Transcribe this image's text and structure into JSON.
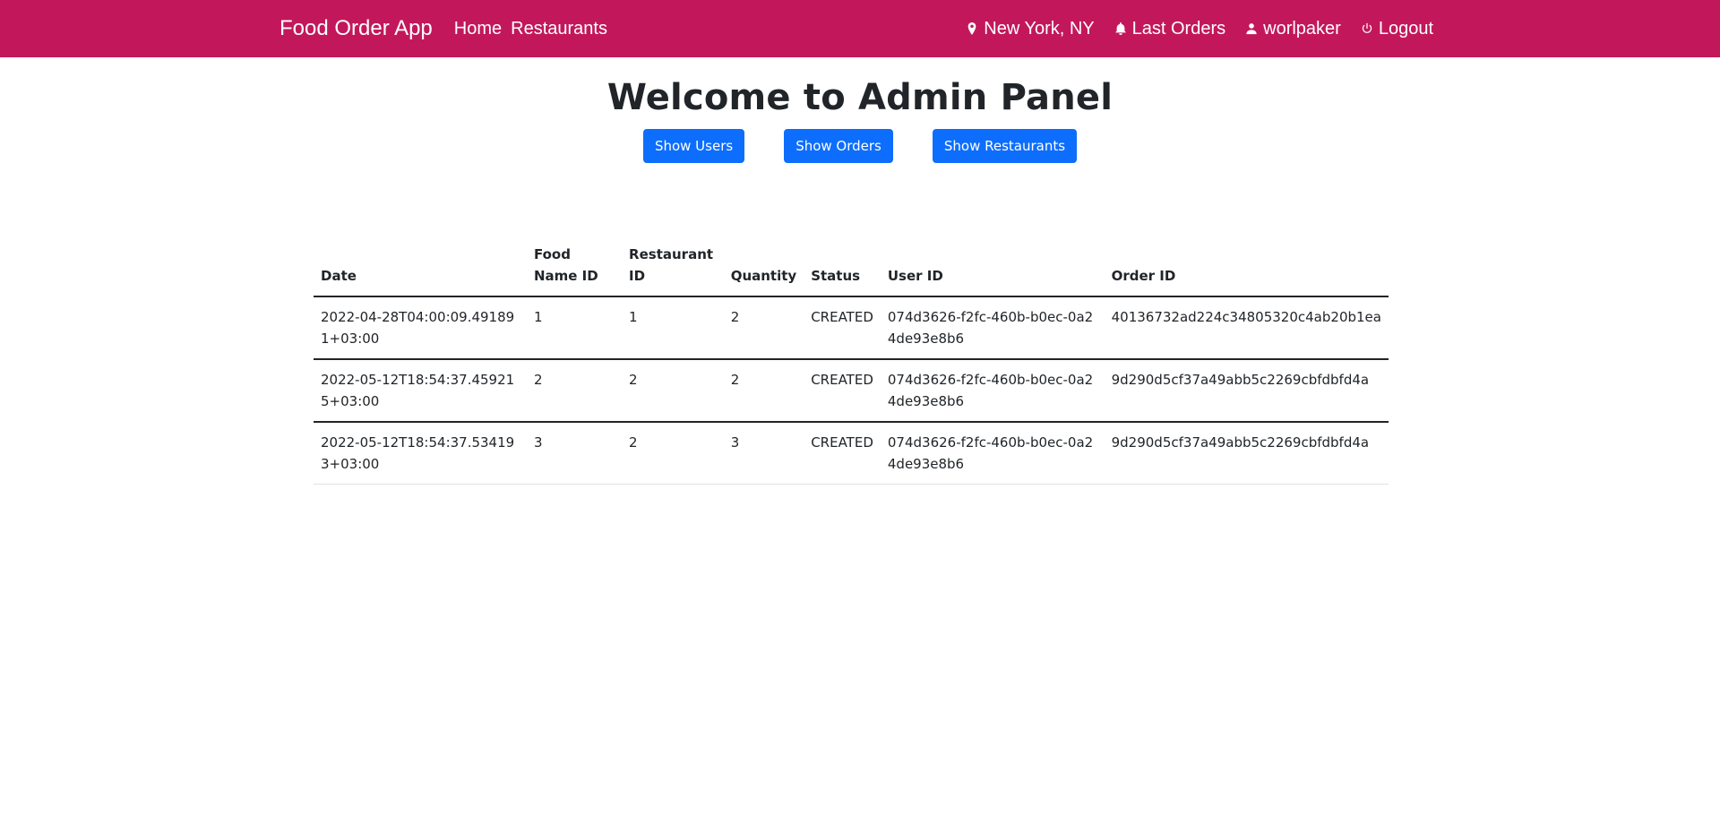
{
  "navbar": {
    "brand": "Food Order App",
    "links": [
      "Home",
      "Restaurants"
    ],
    "location": "New York, NY",
    "last_orders": "Last Orders",
    "username": "worlpaker",
    "logout": "Logout",
    "bg_color": "#c2185b"
  },
  "main": {
    "title": "Welcome to Admin Panel",
    "buttons": [
      "Show Users",
      "Show Orders",
      "Show Restaurants"
    ],
    "button_color": "#0d6efd"
  },
  "table": {
    "headers": {
      "date": "Date",
      "food_name_id": "Food Name ID",
      "restaurant_id": "Restaurant ID",
      "quantity": "Quantity",
      "status": "Status",
      "user_id": "User ID",
      "order_id": "Order ID"
    },
    "rows": [
      {
        "date": "2022-04-28T04:00:09.491891+03:00",
        "food_name_id": "1",
        "restaurant_id": "1",
        "quantity": "2",
        "status": "CREATED",
        "user_id": "074d3626-f2fc-460b-b0ec-0a24de93e8b6",
        "order_id": "40136732ad224c34805320c4ab20b1ea"
      },
      {
        "date": "2022-05-12T18:54:37.459215+03:00",
        "food_name_id": "2",
        "restaurant_id": "2",
        "quantity": "2",
        "status": "CREATED",
        "user_id": "074d3626-f2fc-460b-b0ec-0a24de93e8b6",
        "order_id": "9d290d5cf37a49abb5c2269cbfdbfd4a"
      },
      {
        "date": "2022-05-12T18:54:37.534193+03:00",
        "food_name_id": "3",
        "restaurant_id": "2",
        "quantity": "3",
        "status": "CREATED",
        "user_id": "074d3626-f2fc-460b-b0ec-0a24de93e8b6",
        "order_id": "9d290d5cf37a49abb5c2269cbfdbfd4a"
      }
    ]
  },
  "icons": {
    "location": "map-pin-icon",
    "last_orders": "bell-icon",
    "user": "person-icon",
    "logout": "power-icon"
  }
}
